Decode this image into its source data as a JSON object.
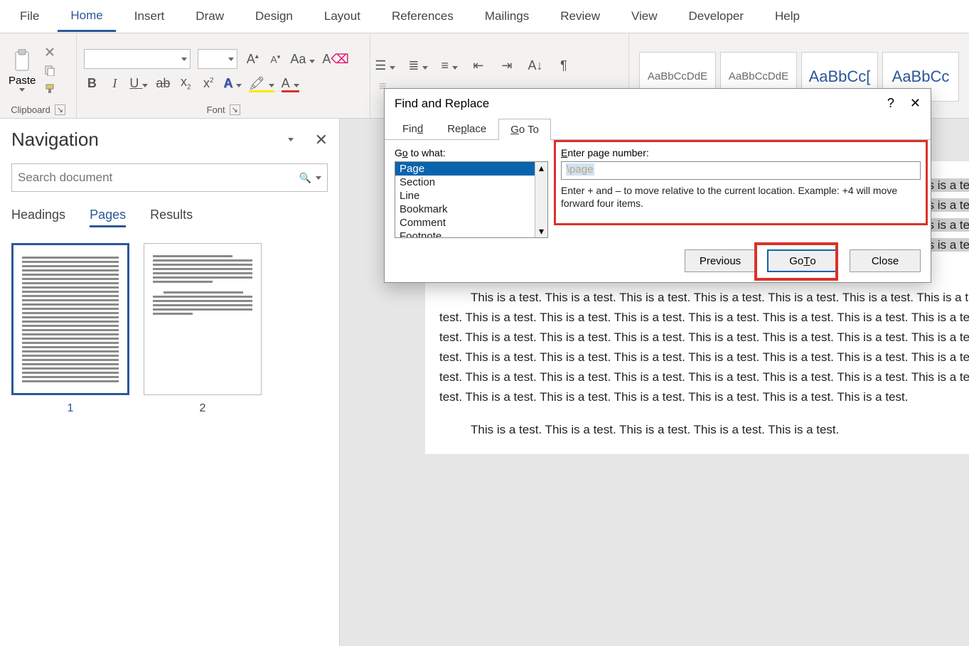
{
  "ribbon": {
    "tabs": [
      "File",
      "Home",
      "Insert",
      "Draw",
      "Design",
      "Layout",
      "References",
      "Mailings",
      "Review",
      "View",
      "Developer",
      "Help"
    ],
    "active_tab": "Home",
    "clipboard": {
      "paste": "Paste",
      "label": "Clipboard"
    },
    "font": {
      "label": "Font",
      "name_value": "",
      "size_value": "",
      "bold": "B",
      "italic": "I",
      "underline": "U",
      "strike": "ab",
      "sub": "x",
      "sup": "x",
      "text_effects": "A",
      "highlight": "A",
      "font_color": "A",
      "grow": "A",
      "shrink": "A",
      "case": "Aa",
      "clear": "A"
    },
    "styles": {
      "items": [
        "AaBbCcDdE",
        "AaBbCcDdE",
        "AaBbCc[",
        "AaBbCc"
      ]
    }
  },
  "navigation": {
    "title": "Navigation",
    "search_placeholder": "Search document",
    "tabs": [
      "Headings",
      "Pages",
      "Results"
    ],
    "active_tab": "Pages",
    "thumbs": [
      {
        "label": "1",
        "active": true
      },
      {
        "label": "2",
        "active": false
      }
    ]
  },
  "dialog": {
    "title": "Find and Replace",
    "tabs": {
      "find": "Find",
      "replace": "Replace",
      "goto": "Go To"
    },
    "active_tab": "Go To",
    "goto_what_label": "Go to what:",
    "goto_what_items": [
      "Page",
      "Section",
      "Line",
      "Bookmark",
      "Comment",
      "Footnote"
    ],
    "goto_what_selected": "Page",
    "enter_label": "Enter page number:",
    "enter_value": "\\page",
    "help_text": "Enter + and – to move relative to the current location. Example: +4 will move forward four items.",
    "buttons": {
      "previous": "Previous",
      "goto": "Go To",
      "close": "Close"
    }
  },
  "document": {
    "para1": "test. This is a test. This is a test. This is a test. This is a test. This is a test. This is a test. This is a test. This is a test. This is a test. This is a test. This is a test. This is a test. This is a test. This is a test. This is a test. This is a test. This is a test. This is a test. This is a test. This is a test. This is a test. This is a test. This is a test. This is a test. This is a test. This is a test. This is a test. This is a test. This is a test. This is a test. This is a test. This is a test. This is a test.",
    "para2": "This is a test. This is a test. This is a test. This is a test. This is a test. This is a test. This is a test. This is a test. This is a test. This is a test. This is a test. This is a test. This is a test. This is a test. This is a test. This is a test. This is a test. This is a test. This is a test. This is a test. This is a test. This is a test. This is a test. This is a test. This is a test. This is a test. This is a test. This is a test. This is a test. This is a test. This is a test. This is a test. This is a test. This is a test. This is a test. This is a test. This is a test. This is a test. This is a test. This is a test. This is a test. This is a test. This is a test. This is a test. This is a test. This is a test.",
    "para3": "This is a test. This is a test. This is a test. This is a test. This is a test."
  }
}
